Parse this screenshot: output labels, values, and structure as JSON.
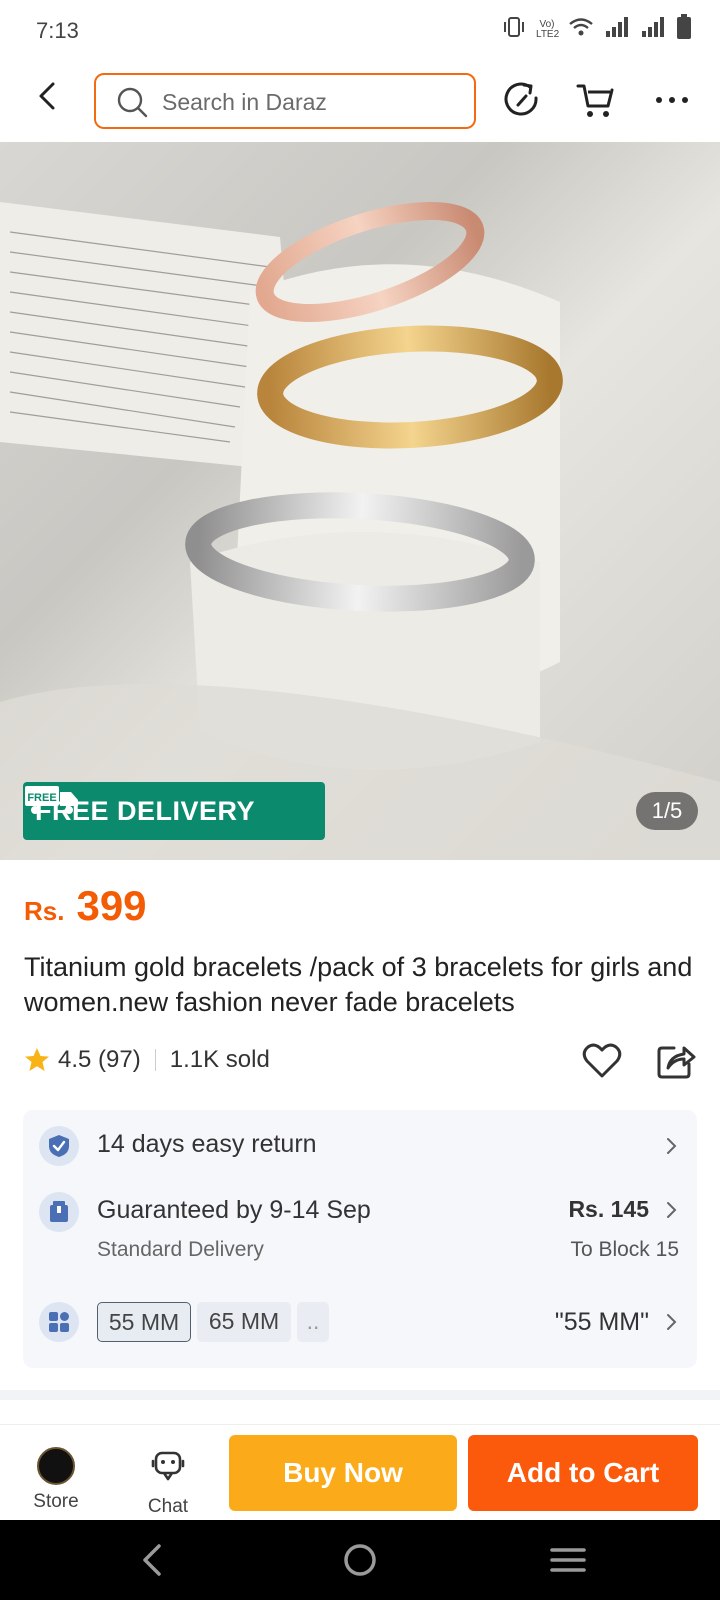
{
  "status_bar": {
    "time": "7:13",
    "network_label": "Vo) LTE2"
  },
  "header": {
    "search_placeholder": "Search in Daraz",
    "accent_color": "#f26a12"
  },
  "gallery": {
    "badge_text": "FREE DELIVERY",
    "badge_truck_text": "FREE",
    "counter": "1/5"
  },
  "product": {
    "currency": "Rs.",
    "price": "399",
    "title": "Titanium gold bracelets /pack of 3 bracelets for girls and women.new fashion never fade bracelets",
    "rating": "4.5 (97)",
    "sold": "1.1K sold"
  },
  "info": {
    "return_text": "14 days easy return",
    "delivery_title": "Guaranteed by 9-14 Sep",
    "delivery_type": "Standard Delivery",
    "delivery_price": "Rs. 145",
    "delivery_location": "To Block 15",
    "variants": [
      "55 MM",
      "65 MM",
      ".."
    ],
    "selected_variant": "\"55 MM\""
  },
  "action_bar": {
    "store_label": "Store",
    "chat_label": "Chat",
    "buy_now_label": "Buy Now",
    "add_to_cart_label": "Add to Cart",
    "buy_now_color": "#fbab1a",
    "add_to_cart_color": "#fb5a0c"
  }
}
